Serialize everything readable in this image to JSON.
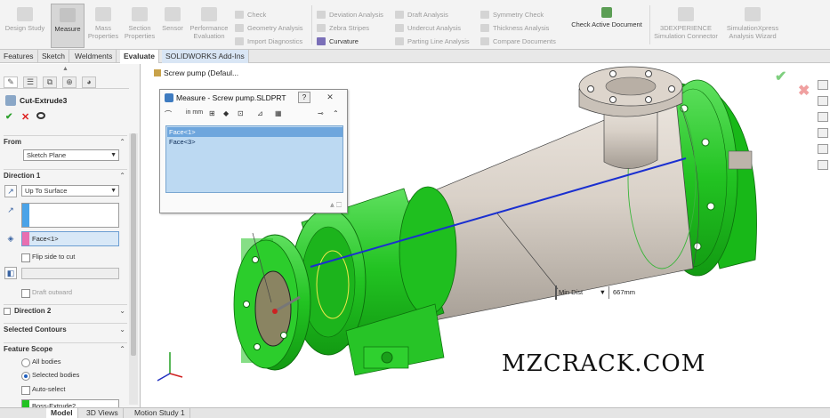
{
  "ribbon": {
    "large_buttons": [
      {
        "label": "Design Study",
        "icon": "design-study-icon"
      },
      {
        "label": "Measure",
        "icon": "measure-icon",
        "active": true
      },
      {
        "label": "Mass Properties",
        "icon": "mass-properties-icon"
      },
      {
        "label": "Section Properties",
        "icon": "section-properties-icon"
      },
      {
        "label": "Sensor",
        "icon": "sensor-icon"
      },
      {
        "label": "Performance Evaluation",
        "icon": "performance-icon"
      }
    ],
    "small_buttons": {
      "col1": [
        "Check",
        "Geometry Analysis",
        "Import Diagnostics"
      ],
      "col2": [
        "Deviation Analysis",
        "Zebra Stripes",
        "Curvature"
      ],
      "col3": [
        "Draft Analysis",
        "Undercut Analysis",
        "Parting Line Analysis"
      ],
      "col4": [
        "Symmetry Check",
        "Thickness Analysis",
        "Compare Documents"
      ]
    },
    "check_active": "Check Active Document",
    "connector": "3DEXPERIENCE Simulation Connector",
    "xpress": "SimulationXpress Analysis Wizard"
  },
  "tabs": [
    "Features",
    "Sketch",
    "Weldments",
    "Evaluate",
    "SOLIDWORKS Add-Ins"
  ],
  "active_tab": "Evaluate",
  "property_manager": {
    "title": "Cut-Extrude3",
    "from_label": "From",
    "from_value": "Sketch Plane",
    "direction1_label": "Direction 1",
    "end_condition": "Up To Surface",
    "face_ref": "Face<1>",
    "flip_side": "Flip side to cut",
    "draft_outward": "Draft outward",
    "direction2_label": "Direction 2",
    "selected_contours": "Selected Contours",
    "feature_scope": "Feature Scope",
    "scope_all": "All bodies",
    "scope_selected": "Selected bodies",
    "auto_select": "Auto-select",
    "body_item": "Boss-Extrude2"
  },
  "tree_flyout": "Screw pump (Defaul...",
  "measure": {
    "title": "Measure - Screw pump.SLDPRT",
    "help": "?",
    "units": "in mm",
    "items": [
      "Face<1>",
      "Face<3>"
    ],
    "min_dist_label": "Min Dist",
    "min_dist_value": "667mm"
  },
  "bottom_tabs": [
    "Model",
    "3D Views",
    "Motion Study 1"
  ],
  "watermark": "MZCRACK.COM",
  "colors": {
    "highlight_green": "#1ec81e",
    "body_tan": "#d9d1c8",
    "axis_blue": "#1a2fd0",
    "active_blue": "#1f5fbf"
  }
}
